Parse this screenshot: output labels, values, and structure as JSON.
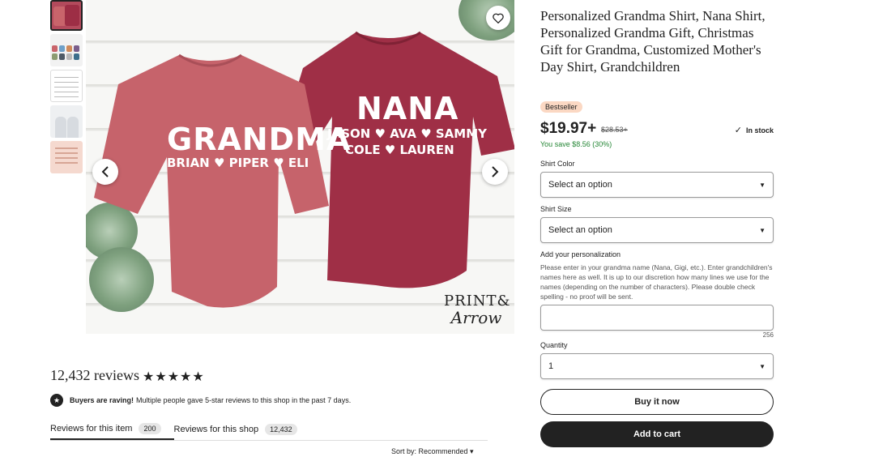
{
  "gallery": {
    "thumbnails": [
      "thumb-1",
      "thumb-2",
      "thumb-3",
      "thumb-4",
      "thumb-5"
    ],
    "image_text": {
      "left_shirt_title": "GRANDMA",
      "left_shirt_names": "BRIAN ♥ PIPER ♥ ELI",
      "right_shirt_title": "NANA",
      "right_shirt_names_1": "JASON ♥ AVA ♥ SAMMY",
      "right_shirt_names_2": "COLE ♥ LAUREN",
      "logo_line1": "PRINT&",
      "logo_line2": "Arrow"
    },
    "icons": {
      "favorite": "heart-icon",
      "prev": "chevron-left-icon",
      "next": "chevron-right-icon"
    }
  },
  "reviews": {
    "title": "12,432 reviews",
    "stars": "★★★★★",
    "raving_bold": "Buyers are raving!",
    "raving_text": "Multiple people gave 5-star reviews to this shop in the past 7 days.",
    "tab_item_label": "Reviews for this item",
    "tab_item_count": "200",
    "tab_shop_label": "Reviews for this shop",
    "tab_shop_count": "12,432",
    "sort_label": "Sort by: Recommended ▾"
  },
  "product": {
    "title": "Personalized Grandma Shirt, Nana Shirt, Personalized Grandma Gift, Christmas Gift for Grandma, Customized Mother's Day Shirt, Grandchildren",
    "badge": "Bestseller",
    "price": "$19.97+",
    "old_price": "$28.53+",
    "stock": "In stock",
    "savings": "You save $8.56 (30%)",
    "color_label": "Shirt Color",
    "color_value": "Select an option",
    "size_label": "Shirt Size",
    "size_value": "Select an option",
    "personalization_label": "Add your personalization",
    "personalization_instructions": "Please enter in your grandma name (Nana, Gigi, etc.). Enter grandchildren's names here as well. It is up to our discretion how many lines we use for the names (depending on the number of characters). Please double check spelling - no proof will be sent.",
    "char_count": "256",
    "quantity_label": "Quantity",
    "quantity_value": "1",
    "buy_now": "Buy it now",
    "add_to_cart": "Add to cart"
  },
  "colors": {
    "accent_dark": "#222222",
    "badge_bg": "#fbd8c3",
    "savings_green": "#258635",
    "left_shirt": "#c6636b",
    "right_shirt": "#9f2f46"
  }
}
